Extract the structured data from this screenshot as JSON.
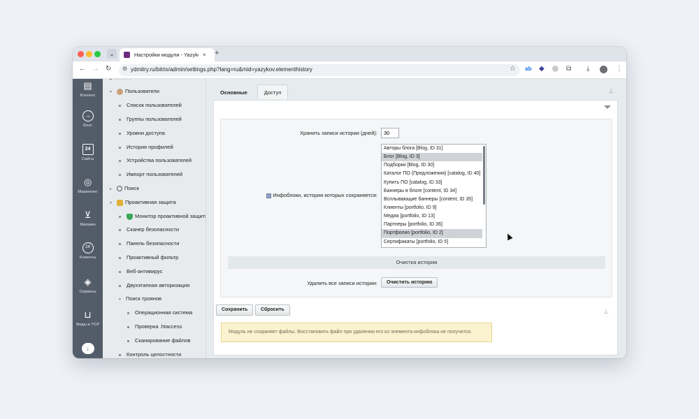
{
  "browser": {
    "tab_title": "Настройки модуля - Yazyko",
    "tab_close": "×",
    "new_tab": "+",
    "url": "ydmitry.ru/bitrix/admin/settings.php?lang=ru&mid=yazykov.elementhistory",
    "nav": {
      "back": "←",
      "forward": "→",
      "reload": "↻"
    },
    "extensions": [
      "ab",
      "◆",
      "◎",
      "⧉",
      "⤓",
      "⋮"
    ]
  },
  "rail": {
    "items": [
      {
        "label": "Контент",
        "icon": "document-icon"
      },
      {
        "label": "Блог",
        "icon": "arrow-circle-icon"
      },
      {
        "label": "Сайты",
        "icon": "calendar-icon"
      },
      {
        "label": "Маркетинг",
        "icon": "target-icon"
      },
      {
        "label": "Магазин",
        "icon": "basket-icon"
      },
      {
        "label": "Клиенты",
        "icon": "clients-icon"
      },
      {
        "label": "Сервисы",
        "icon": "layers-icon"
      },
      {
        "label": "Фиды и YCP",
        "icon": "cart-icon"
      },
      {
        "label": "",
        "icon": "cloud-icon"
      }
    ]
  },
  "tree": {
    "items": [
      {
        "label": "Пользователи",
        "level": 0,
        "caret": "▾",
        "icon": "user-icon"
      },
      {
        "label": "Список пользователей",
        "level": 1
      },
      {
        "label": "Группы пользователей",
        "level": 1
      },
      {
        "label": "Уровни доступа",
        "level": 1
      },
      {
        "label": "История профилей",
        "level": 1
      },
      {
        "label": "Устройства пользователей",
        "level": 1
      },
      {
        "label": "Импорт пользователей",
        "level": 1
      },
      {
        "label": "Поиск",
        "level": 0,
        "caret": "▸",
        "icon": "search-icon"
      },
      {
        "label": "Проактивная защита",
        "level": 0,
        "caret": "▾",
        "icon": "lock-icon"
      },
      {
        "label": "Монитор проактивной защиты",
        "level": 1,
        "icon": "shield-icon"
      },
      {
        "label": "Сканер безопасности",
        "level": 1
      },
      {
        "label": "Панель безопасности",
        "level": 1
      },
      {
        "label": "Проактивный фильтр",
        "level": 1
      },
      {
        "label": "Веб-антивирус",
        "level": 1
      },
      {
        "label": "Двухэтапная авторизация",
        "level": 1
      },
      {
        "label": "Поиск троянов",
        "level": 1,
        "caret": "▾"
      },
      {
        "label": "Операционная система",
        "level": 2
      },
      {
        "label": "Проверка .htaccess",
        "level": 2
      },
      {
        "label": "Сканирование файлов",
        "level": 2
      },
      {
        "label": "Контроль целостности",
        "level": 1
      }
    ]
  },
  "tabs": [
    {
      "label": "Основные",
      "active": true
    },
    {
      "label": "Доступ",
      "active": false
    }
  ],
  "form": {
    "days_label": "Хранить записи истории (дней):",
    "days_value": "30",
    "iblocks_label": "Инфоблоки, история которых сохраняется:",
    "iblocks_options": [
      {
        "label": "Авторы блога [Blog, ID 31]",
        "selected": false
      },
      {
        "label": "Блог [Blog, ID 3]",
        "selected": true
      },
      {
        "label": "Подборки [Blog, ID 30]",
        "selected": false
      },
      {
        "label": "Каталог ПО (Предложения) [catalog, ID 40]",
        "selected": false
      },
      {
        "label": "Купить ПО [catalog, ID 33]",
        "selected": false
      },
      {
        "label": "Баннеры в блоге [content, ID 34]",
        "selected": false
      },
      {
        "label": "Всплывающие баннеры [content, ID 35]",
        "selected": false
      },
      {
        "label": "Клиенты [portfolio, ID 9]",
        "selected": false
      },
      {
        "label": "Медиа [portfolio, ID 13]",
        "selected": false
      },
      {
        "label": "Партнеры [portfolio, ID 36]",
        "selected": false
      },
      {
        "label": "Портфолио [portfolio, ID 2]",
        "selected": true
      },
      {
        "label": "Сертификаты [portfolio, ID 5]",
        "selected": false
      }
    ],
    "clear_section_title": "Очистка истории",
    "delete_label": "Удалить все записи истории:",
    "clear_button": "Очистить историю"
  },
  "footer": {
    "save": "Сохранить",
    "reset": "Сбросить",
    "note": "Модуль не сохраняет файлы. Восстановить файл при удалении его из элемента инфоблока не получится."
  }
}
